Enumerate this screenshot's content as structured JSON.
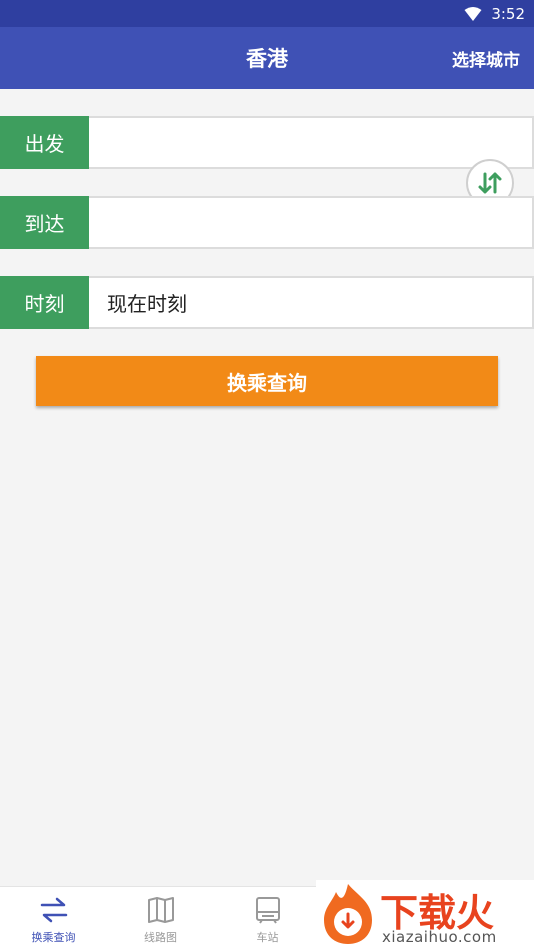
{
  "status_bar": {
    "time": "3:52",
    "icons": [
      "wifi-icon"
    ]
  },
  "header": {
    "title": "香港",
    "city_button_label": "选择城市",
    "background_color": "#3f51b5"
  },
  "form": {
    "departure": {
      "label": "出发",
      "value": ""
    },
    "arrival": {
      "label": "到达",
      "value": ""
    },
    "time": {
      "label": "时刻",
      "value": "现在时刻"
    },
    "swap_icon": "swap-arrows-icon",
    "label_color": "#3e9e5e",
    "query_button_label": "换乘查询",
    "query_button_color": "#f28a17"
  },
  "bottom_nav": {
    "items": [
      {
        "label": "换乘查询",
        "icon": "transfer-icon",
        "active": true
      },
      {
        "label": "线路图",
        "icon": "map-icon",
        "active": false
      },
      {
        "label": "车站",
        "icon": "station-icon",
        "active": false
      }
    ]
  },
  "watermark": {
    "brand": "下载火",
    "domain": "xiazaihuo.com"
  }
}
